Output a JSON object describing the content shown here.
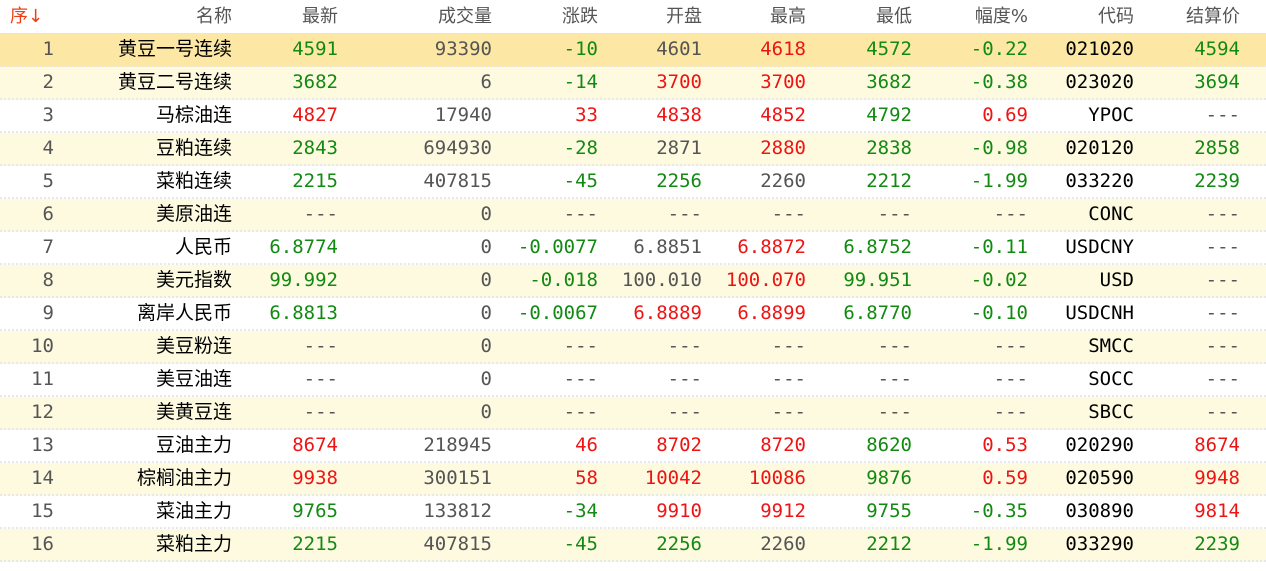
{
  "columns": {
    "seq": "序",
    "seq_sort_icon": "arrow-down-icon",
    "seq_arrow": "↓",
    "name": "名称",
    "last": "最新",
    "volume": "成交量",
    "change": "涨跌",
    "open": "开盘",
    "high": "最高",
    "low": "最低",
    "pct": "幅度%",
    "code": "代码",
    "settle": "结算价"
  },
  "colors": {
    "up": "#ee1414",
    "down": "#128a12",
    "neutral": "#555555",
    "row_selected": "#fce8a4",
    "row_alt": "#fdfae0"
  },
  "selected_row": 0,
  "rows": [
    {
      "seq": "1",
      "name": "黄豆一号连续",
      "last": "4591",
      "last_c": "down",
      "volume": "93390",
      "change": "-10",
      "change_c": "down",
      "open": "4601",
      "open_c": "flat",
      "high": "4618",
      "high_c": "up",
      "low": "4572",
      "low_c": "down",
      "pct": "-0.22",
      "pct_c": "down",
      "code": "021020",
      "settle": "4594",
      "settle_c": "down"
    },
    {
      "seq": "2",
      "name": "黄豆二号连续",
      "last": "3682",
      "last_c": "down",
      "volume": "6",
      "change": "-14",
      "change_c": "down",
      "open": "3700",
      "open_c": "up",
      "high": "3700",
      "high_c": "up",
      "low": "3682",
      "low_c": "down",
      "pct": "-0.38",
      "pct_c": "down",
      "code": "023020",
      "settle": "3694",
      "settle_c": "down"
    },
    {
      "seq": "3",
      "name": "马棕油连",
      "last": "4827",
      "last_c": "up",
      "volume": "17940",
      "change": "33",
      "change_c": "up",
      "open": "4838",
      "open_c": "up",
      "high": "4852",
      "high_c": "up",
      "low": "4792",
      "low_c": "down",
      "pct": "0.69",
      "pct_c": "up",
      "code": "YPOC",
      "settle": "---",
      "settle_c": "dash"
    },
    {
      "seq": "4",
      "name": "豆粕连续",
      "last": "2843",
      "last_c": "down",
      "volume": "694930",
      "change": "-28",
      "change_c": "down",
      "open": "2871",
      "open_c": "flat",
      "high": "2880",
      "high_c": "up",
      "low": "2838",
      "low_c": "down",
      "pct": "-0.98",
      "pct_c": "down",
      "code": "020120",
      "settle": "2858",
      "settle_c": "down"
    },
    {
      "seq": "5",
      "name": "菜粕连续",
      "last": "2215",
      "last_c": "down",
      "volume": "407815",
      "change": "-45",
      "change_c": "down",
      "open": "2256",
      "open_c": "down",
      "high": "2260",
      "high_c": "flat",
      "low": "2212",
      "low_c": "down",
      "pct": "-1.99",
      "pct_c": "down",
      "code": "033220",
      "settle": "2239",
      "settle_c": "down"
    },
    {
      "seq": "6",
      "name": "美原油连",
      "last": "---",
      "last_c": "dash",
      "volume": "0",
      "change": "---",
      "change_c": "dash",
      "open": "---",
      "open_c": "dash",
      "high": "---",
      "high_c": "dash",
      "low": "---",
      "low_c": "dash",
      "pct": "---",
      "pct_c": "dash",
      "code": "CONC",
      "settle": "---",
      "settle_c": "dash"
    },
    {
      "seq": "7",
      "name": "人民币",
      "last": "6.8774",
      "last_c": "down",
      "volume": "0",
      "change": "-0.0077",
      "change_c": "down",
      "open": "6.8851",
      "open_c": "flat",
      "high": "6.8872",
      "high_c": "up",
      "low": "6.8752",
      "low_c": "down",
      "pct": "-0.11",
      "pct_c": "down",
      "code": "USDCNY",
      "settle": "---",
      "settle_c": "dash"
    },
    {
      "seq": "8",
      "name": "美元指数",
      "last": "99.992",
      "last_c": "down",
      "volume": "0",
      "change": "-0.018",
      "change_c": "down",
      "open": "100.010",
      "open_c": "flat",
      "high": "100.070",
      "high_c": "up",
      "low": "99.951",
      "low_c": "down",
      "pct": "-0.02",
      "pct_c": "down",
      "code": "USD",
      "settle": "---",
      "settle_c": "dash"
    },
    {
      "seq": "9",
      "name": "离岸人民币",
      "last": "6.8813",
      "last_c": "down",
      "volume": "0",
      "change": "-0.0067",
      "change_c": "down",
      "open": "6.8889",
      "open_c": "up",
      "high": "6.8899",
      "high_c": "up",
      "low": "6.8770",
      "low_c": "down",
      "pct": "-0.10",
      "pct_c": "down",
      "code": "USDCNH",
      "settle": "---",
      "settle_c": "dash"
    },
    {
      "seq": "10",
      "name": "美豆粉连",
      "last": "---",
      "last_c": "dash",
      "volume": "0",
      "change": "---",
      "change_c": "dash",
      "open": "---",
      "open_c": "dash",
      "high": "---",
      "high_c": "dash",
      "low": "---",
      "low_c": "dash",
      "pct": "---",
      "pct_c": "dash",
      "code": "SMCC",
      "settle": "---",
      "settle_c": "dash"
    },
    {
      "seq": "11",
      "name": "美豆油连",
      "last": "---",
      "last_c": "dash",
      "volume": "0",
      "change": "---",
      "change_c": "dash",
      "open": "---",
      "open_c": "dash",
      "high": "---",
      "high_c": "dash",
      "low": "---",
      "low_c": "dash",
      "pct": "---",
      "pct_c": "dash",
      "code": "SOCC",
      "settle": "---",
      "settle_c": "dash"
    },
    {
      "seq": "12",
      "name": "美黄豆连",
      "last": "---",
      "last_c": "dash",
      "volume": "0",
      "change": "---",
      "change_c": "dash",
      "open": "---",
      "open_c": "dash",
      "high": "---",
      "high_c": "dash",
      "low": "---",
      "low_c": "dash",
      "pct": "---",
      "pct_c": "dash",
      "code": "SBCC",
      "settle": "---",
      "settle_c": "dash"
    },
    {
      "seq": "13",
      "name": "豆油主力",
      "last": "8674",
      "last_c": "up",
      "volume": "218945",
      "change": "46",
      "change_c": "up",
      "open": "8702",
      "open_c": "up",
      "high": "8720",
      "high_c": "up",
      "low": "8620",
      "low_c": "down",
      "pct": "0.53",
      "pct_c": "up",
      "code": "020290",
      "settle": "8674",
      "settle_c": "up"
    },
    {
      "seq": "14",
      "name": "棕榈油主力",
      "last": "9938",
      "last_c": "up",
      "volume": "300151",
      "change": "58",
      "change_c": "up",
      "open": "10042",
      "open_c": "up",
      "high": "10086",
      "high_c": "up",
      "low": "9876",
      "low_c": "down",
      "pct": "0.59",
      "pct_c": "up",
      "code": "020590",
      "settle": "9948",
      "settle_c": "up"
    },
    {
      "seq": "15",
      "name": "菜油主力",
      "last": "9765",
      "last_c": "down",
      "volume": "133812",
      "change": "-34",
      "change_c": "down",
      "open": "9910",
      "open_c": "up",
      "high": "9912",
      "high_c": "up",
      "low": "9755",
      "low_c": "down",
      "pct": "-0.35",
      "pct_c": "down",
      "code": "030890",
      "settle": "9814",
      "settle_c": "up"
    },
    {
      "seq": "16",
      "name": "菜粕主力",
      "last": "2215",
      "last_c": "down",
      "volume": "407815",
      "change": "-45",
      "change_c": "down",
      "open": "2256",
      "open_c": "down",
      "high": "2260",
      "high_c": "flat",
      "low": "2212",
      "low_c": "down",
      "pct": "-1.99",
      "pct_c": "down",
      "code": "033290",
      "settle": "2239",
      "settle_c": "down"
    }
  ]
}
